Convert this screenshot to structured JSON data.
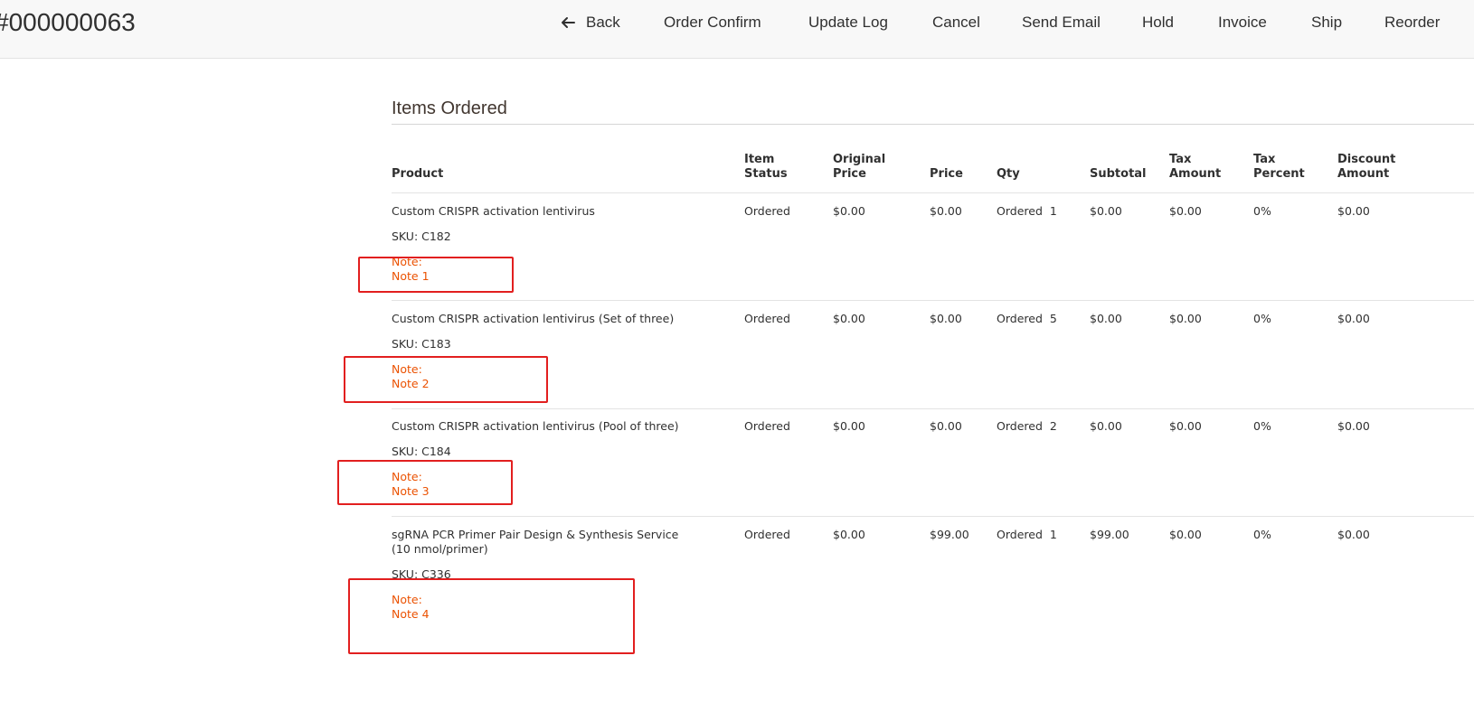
{
  "header": {
    "order_number": "#000000063",
    "actions": {
      "back": "Back",
      "order_confirm": "Order Confirm",
      "update_log": "Update Log",
      "cancel": "Cancel",
      "send_email": "Send Email",
      "hold": "Hold",
      "invoice": "Invoice",
      "ship": "Ship",
      "reorder": "Reorder"
    }
  },
  "items_ordered": {
    "title": "Items Ordered",
    "columns": {
      "product": "Product",
      "item_status": "Item Status",
      "original_price": "Original Price",
      "price": "Price",
      "qty": "Qty",
      "subtotal": "Subtotal",
      "tax_amount": "Tax Amount",
      "tax_percent": "Tax Percent",
      "discount_amount": "Discount Amount"
    },
    "rows": [
      {
        "name": "Custom CRISPR activation lentivirus",
        "sku": "SKU: C182",
        "note_label": "Note:",
        "note_value": "Note 1",
        "status": "Ordered",
        "original_price": "$0.00",
        "price": "$0.00",
        "qty": "Ordered  1",
        "subtotal": "$0.00",
        "tax_amount": "$0.00",
        "tax_percent": "0%",
        "discount_amount": "$0.00"
      },
      {
        "name": "Custom CRISPR activation lentivirus (Set of three)",
        "sku": "SKU: C183",
        "note_label": "Note:",
        "note_value": "Note 2",
        "status": "Ordered",
        "original_price": "$0.00",
        "price": "$0.00",
        "qty": "Ordered  5",
        "subtotal": "$0.00",
        "tax_amount": "$0.00",
        "tax_percent": "0%",
        "discount_amount": "$0.00"
      },
      {
        "name": "Custom CRISPR activation lentivirus (Pool of three)",
        "sku": "SKU: C184",
        "note_label": "Note:",
        "note_value": "Note 3",
        "status": "Ordered",
        "original_price": "$0.00",
        "price": "$0.00",
        "qty": "Ordered  2",
        "subtotal": "$0.00",
        "tax_amount": "$0.00",
        "tax_percent": "0%",
        "discount_amount": "$0.00"
      },
      {
        "name": "sgRNA PCR Primer Pair Design & Synthesis Service (10 nmol/primer)",
        "sku": "SKU: C336",
        "note_label": "Note:",
        "note_value": "Note 4",
        "status": "Ordered",
        "original_price": "$0.00",
        "price": "$99.00",
        "qty": "Ordered  1",
        "subtotal": "$99.00",
        "tax_amount": "$0.00",
        "tax_percent": "0%",
        "discount_amount": "$0.00"
      }
    ]
  },
  "colors": {
    "note_text": "#eb5202",
    "highlight_border": "#e21f1f",
    "header_bg": "#f8f8f8"
  },
  "icons": {
    "back": "arrow-left-icon"
  }
}
